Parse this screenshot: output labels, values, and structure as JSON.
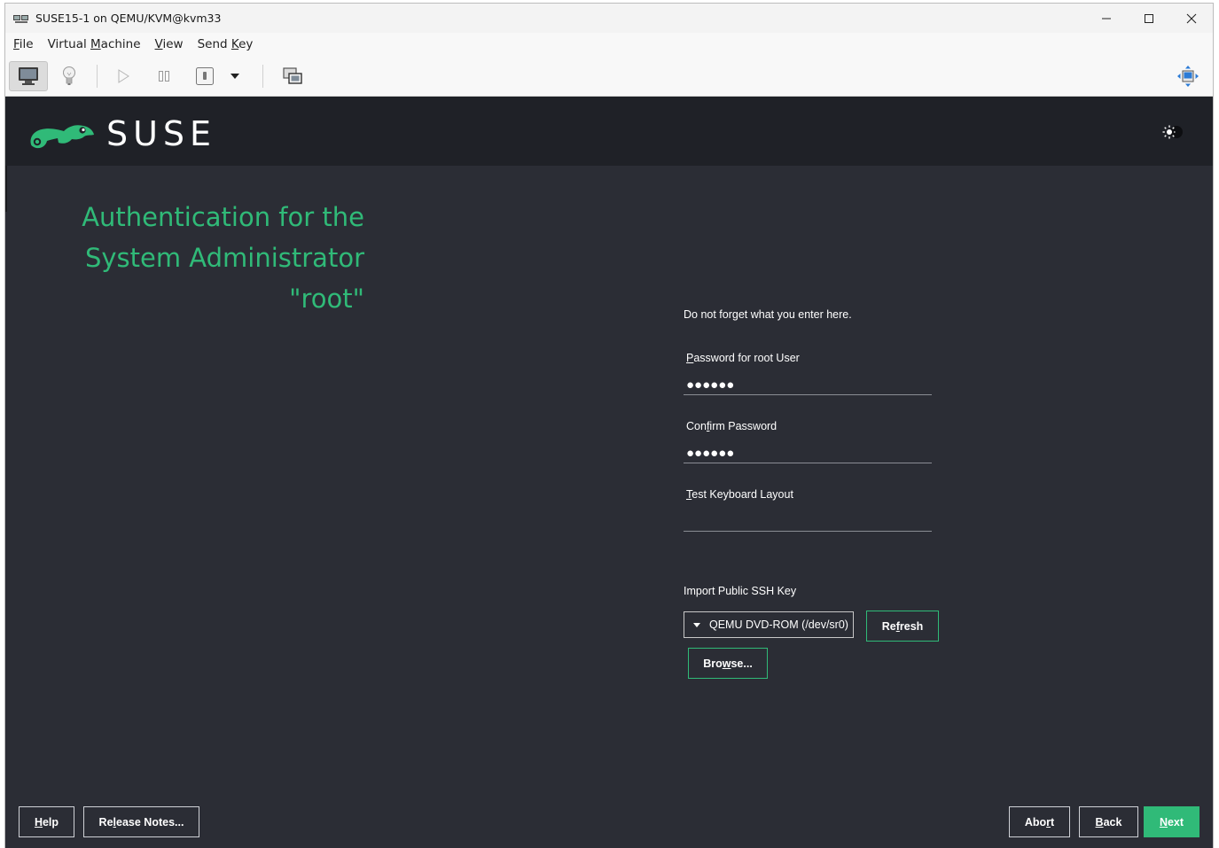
{
  "window": {
    "title": "SUSE15-1 on QEMU/KVM@kvm33"
  },
  "menubar": {
    "items": [
      {
        "pre": "",
        "key": "F",
        "post": "ile"
      },
      {
        "pre": "Virtual ",
        "key": "M",
        "post": "achine"
      },
      {
        "pre": "",
        "key": "V",
        "post": "iew"
      },
      {
        "pre": "Send ",
        "key": "K",
        "post": "ey"
      }
    ]
  },
  "toolbar": {
    "icons": [
      "monitor-icon",
      "lightbulb-icon",
      "play-icon",
      "pause-icon",
      "power-icon",
      "dropdown-arrow-icon",
      "screenshot-icon",
      "fit-window-icon"
    ]
  },
  "installer": {
    "brand": "SUSE",
    "heading_lines": [
      "Authentication for the",
      "System Administrator",
      "\"root\""
    ],
    "hint": "Do not forget what you enter here.",
    "password_label": {
      "key": "P",
      "rest": "assword for root User"
    },
    "password_value": "●●●●●●",
    "confirm_label": {
      "pre": "Con",
      "key": "f",
      "post": "irm Password"
    },
    "confirm_value": "●●●●●●",
    "keyboard_label": {
      "key": "T",
      "rest": "est Keyboard Layout"
    },
    "keyboard_value": "",
    "ssh_label": "Import Public SSH Key",
    "ssh_device": "QEMU DVD-ROM (/dev/sr0)",
    "refresh": {
      "pre": "Re",
      "key": "f",
      "post": "resh"
    },
    "browse": {
      "pre": "Bro",
      "key": "w",
      "post": "se..."
    }
  },
  "footer": {
    "help": {
      "key": "H",
      "rest": "elp"
    },
    "release_notes": {
      "pre": "Re",
      "key": "l",
      "post": "ease Notes..."
    },
    "abort": {
      "pre": "Abo",
      "key": "r",
      "post": "t"
    },
    "back": {
      "key": "B",
      "rest": "ack"
    },
    "next": {
      "key": "N",
      "rest": "ext"
    }
  },
  "colors": {
    "accent": "#30ba78",
    "background": "#2b2d35",
    "header": "#1f2127"
  }
}
